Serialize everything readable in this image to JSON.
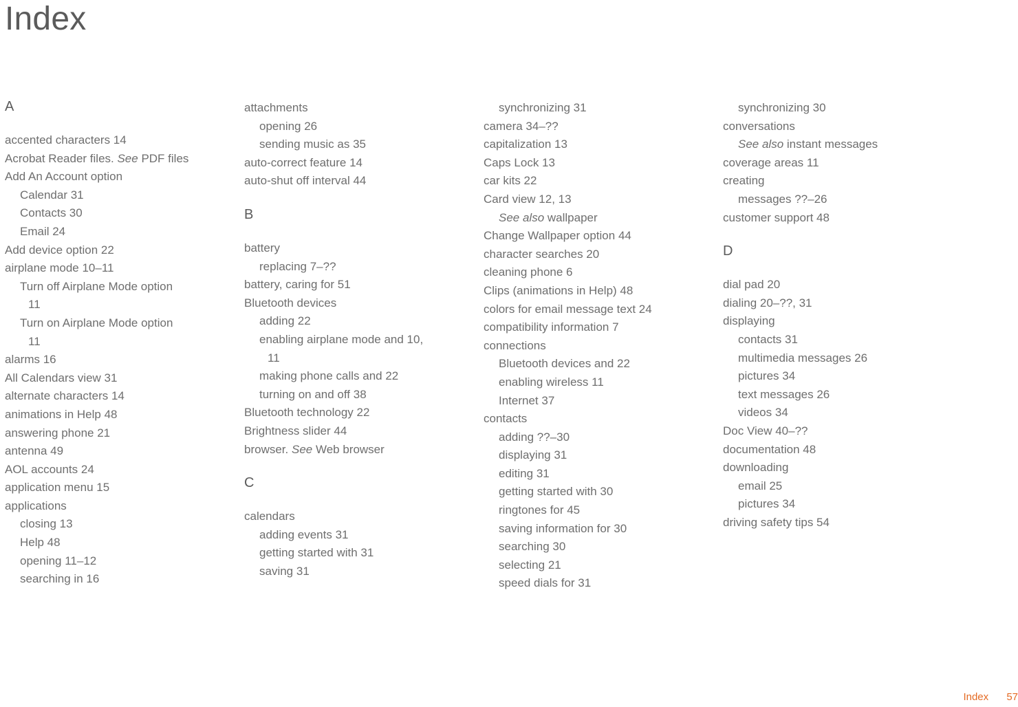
{
  "title": "Index",
  "footer": {
    "label": "Index",
    "page": "57"
  },
  "sections": {
    "A": "A",
    "B": "B",
    "C": "C",
    "D": "D"
  },
  "c1": {
    "e01": "accented characters 14",
    "e02a": "Acrobat Reader files. ",
    "e02b": "See",
    "e02c": " PDF files",
    "e03": "Add An Account option",
    "e03a": "Calendar 31",
    "e03b": "Contacts 30",
    "e03c": "Email 24",
    "e04": "Add device option 22",
    "e05": "airplane mode 10–11",
    "e05a": "Turn off Airplane Mode option ",
    "e05a_p": "11",
    "e05b": "Turn on Airplane Mode option ",
    "e05b_p": "11",
    "e06": "alarms 16",
    "e07": "All Calendars view 31",
    "e08": "alternate characters 14",
    "e09": "animations in Help 48",
    "e10": "answering phone 21",
    "e11": "antenna 49",
    "e12": "AOL accounts 24",
    "e13": "application menu 15",
    "e14": "applications",
    "e14a": "closing 13",
    "e14b": "Help 48",
    "e14c": "opening 11–12",
    "e14d": "searching in 16"
  },
  "c2": {
    "e01": "attachments",
    "e01a": "opening 26",
    "e01b": "sending music as 35",
    "e02": "auto-correct feature 14",
    "e03": "auto-shut off interval 44",
    "e04": "battery",
    "e04a": "replacing 7–??",
    "e05": "battery, caring for 51",
    "e06": "Bluetooth devices",
    "e06a": "adding 22",
    "e06b": "enabling airplane mode and 10, ",
    "e06b_p": "11",
    "e06c": "making phone calls and 22",
    "e06d": "turning on and off 38",
    "e07": "Bluetooth technology 22",
    "e08": "Brightness slider 44",
    "e09a": "browser. ",
    "e09b": "See",
    "e09c": " Web browser",
    "e10": "calendars",
    "e10a": "adding events 31",
    "e10b": "getting started with 31",
    "e10c": "saving 31"
  },
  "c3": {
    "e00a": "synchronizing 31",
    "e01": "camera 34–??",
    "e02": "capitalization 13",
    "e03": "Caps Lock 13",
    "e04": "car kits 22",
    "e05": "Card view 12, 13",
    "e05a_i": "See also",
    "e05a_t": " wallpaper",
    "e06": "Change Wallpaper option 44",
    "e07": "character searches 20",
    "e08": "cleaning phone 6",
    "e09": "Clips (animations in Help) 48",
    "e10": "colors for email message text 24",
    "e11": "compatibility information 7",
    "e12": "connections",
    "e12a": "Bluetooth devices and 22",
    "e12b": "enabling wireless 11",
    "e12c": "Internet 37",
    "e13": "contacts",
    "e13a": "adding ??–30",
    "e13b": "displaying 31",
    "e13c": "editing 31",
    "e13d": "getting started with 30",
    "e13e": "ringtones for 45",
    "e13f": "saving information for 30",
    "e13g": "searching 30",
    "e13h": "selecting 21",
    "e13i": "speed dials for 31"
  },
  "c4": {
    "e00a": "synchronizing 30",
    "e01": "conversations",
    "e01a_i": "See also",
    "e01a_t": " instant messages",
    "e02": "coverage areas 11",
    "e03": "creating",
    "e03a": "messages ??–26",
    "e04": "customer support 48",
    "e05": "dial pad 20",
    "e06": "dialing 20–??, 31",
    "e07": "displaying",
    "e07a": "contacts 31",
    "e07b": "multimedia messages 26",
    "e07c": "pictures 34",
    "e07d": "text messages 26",
    "e07e": "videos 34",
    "e08": "Doc View 40–??",
    "e09": "documentation 48",
    "e10": "downloading",
    "e10a": "email 25",
    "e10b": "pictures 34",
    "e11": "driving safety tips 54"
  }
}
